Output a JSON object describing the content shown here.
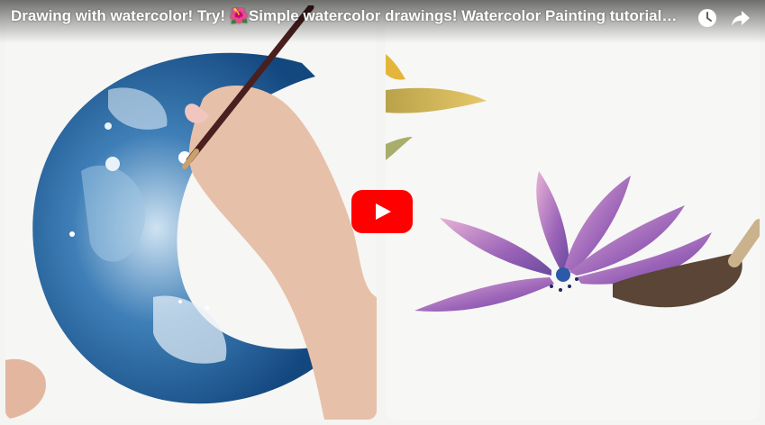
{
  "video": {
    "title": "Drawing with watercolor! Try! 🌺Simple watercolor drawings! Watercolor Painting tutorial! Art...",
    "play_color": "#ff0000"
  },
  "icons": {
    "watch_later": "clock-icon",
    "share": "share-arrow-icon",
    "play": "play-icon"
  }
}
